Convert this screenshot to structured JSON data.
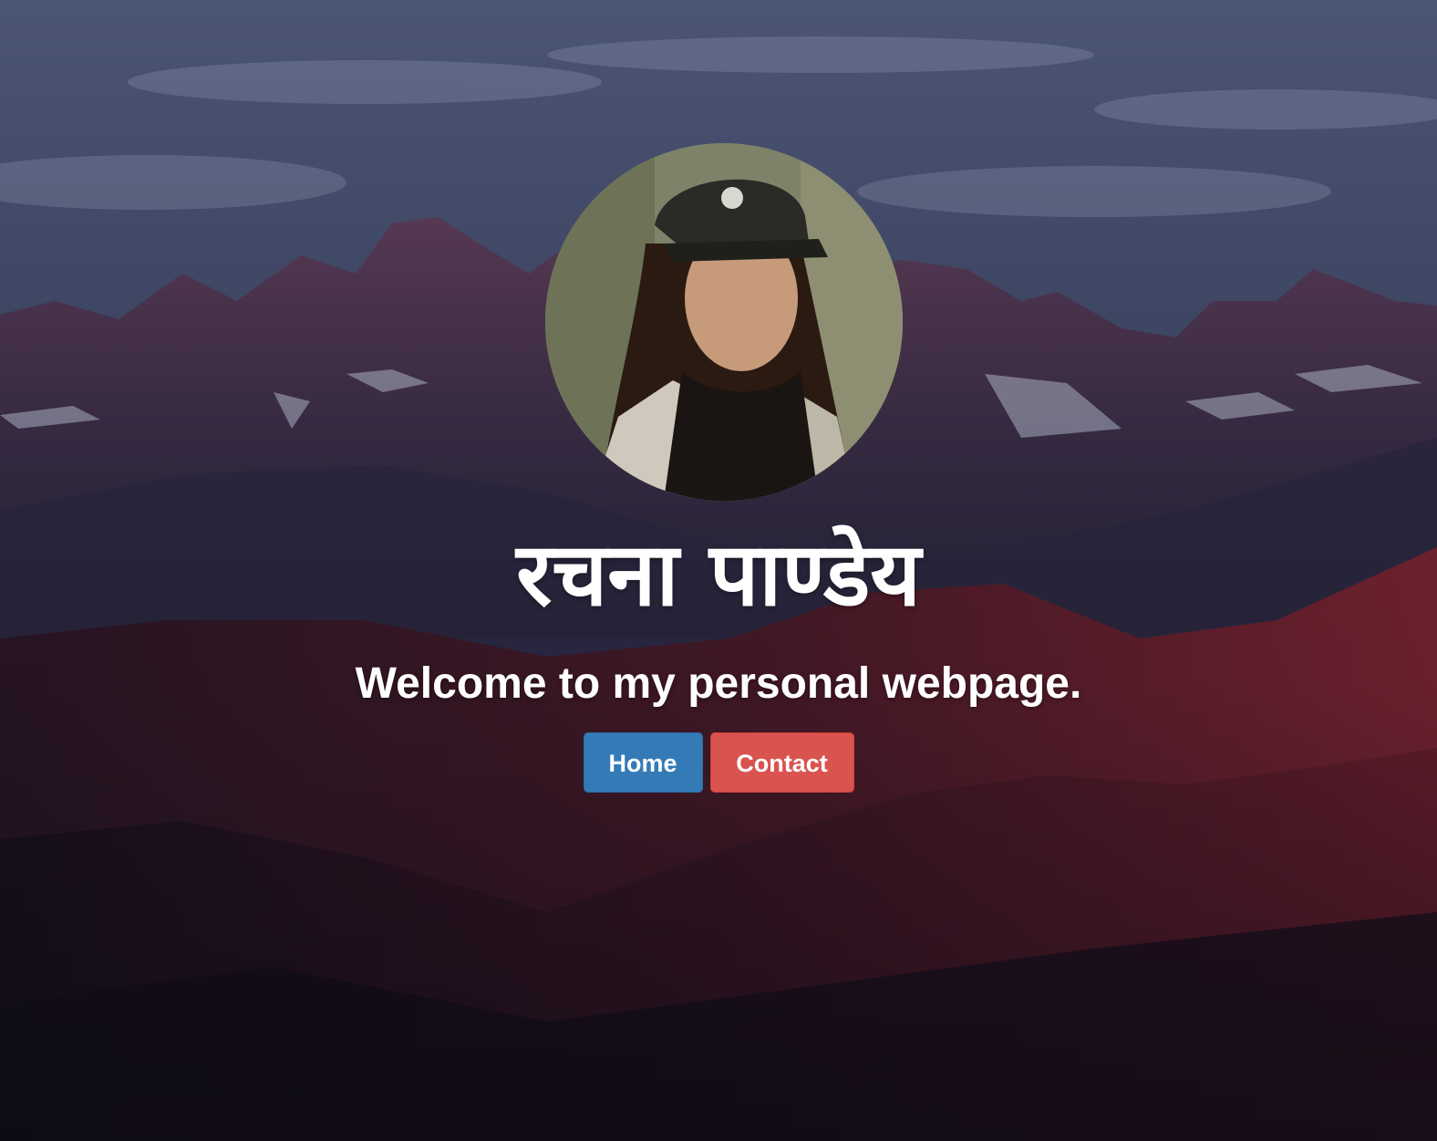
{
  "profile": {
    "name": "रचना पाण्डेय",
    "tagline": "Welcome to my personal webpage.",
    "avatar_alt": "profile-photo"
  },
  "nav": {
    "home_label": "Home",
    "contact_label": "Contact"
  },
  "colors": {
    "home_button": "#337ab7",
    "contact_button": "#d9534f",
    "text": "#ffffff"
  }
}
